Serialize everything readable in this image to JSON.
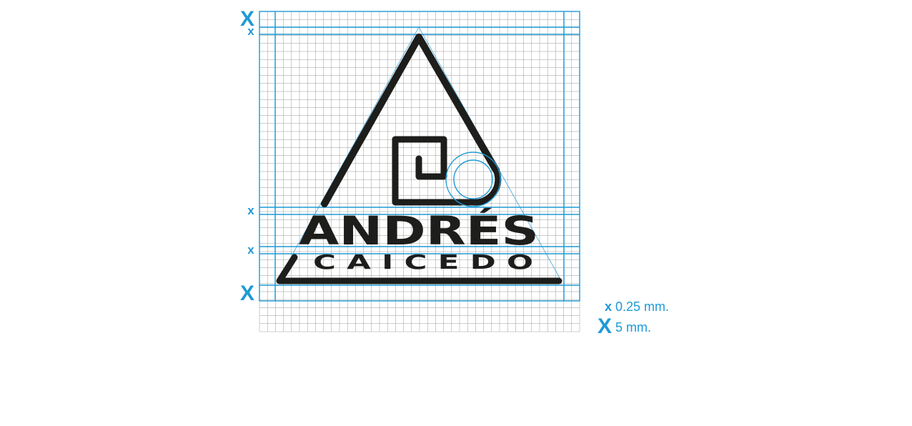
{
  "brand": {
    "name_line1": "ANDRÉS",
    "name_line2": "C A I C E D O"
  },
  "margin_markers": {
    "large": "X",
    "small": "x"
  },
  "legend": {
    "small_symbol": "x",
    "small_value": "0.25 mm.",
    "large_symbol": "X",
    "large_value": "5 mm."
  },
  "colors": {
    "guide_blue": "#1e9ad6",
    "logo_black": "#1d1d1b",
    "grid_gray": "#9a9a9a",
    "background": "#ffffff"
  },
  "icons": {
    "logo": "triangle-spiral-logo",
    "guide_circles": "concentric-circle-guides"
  }
}
